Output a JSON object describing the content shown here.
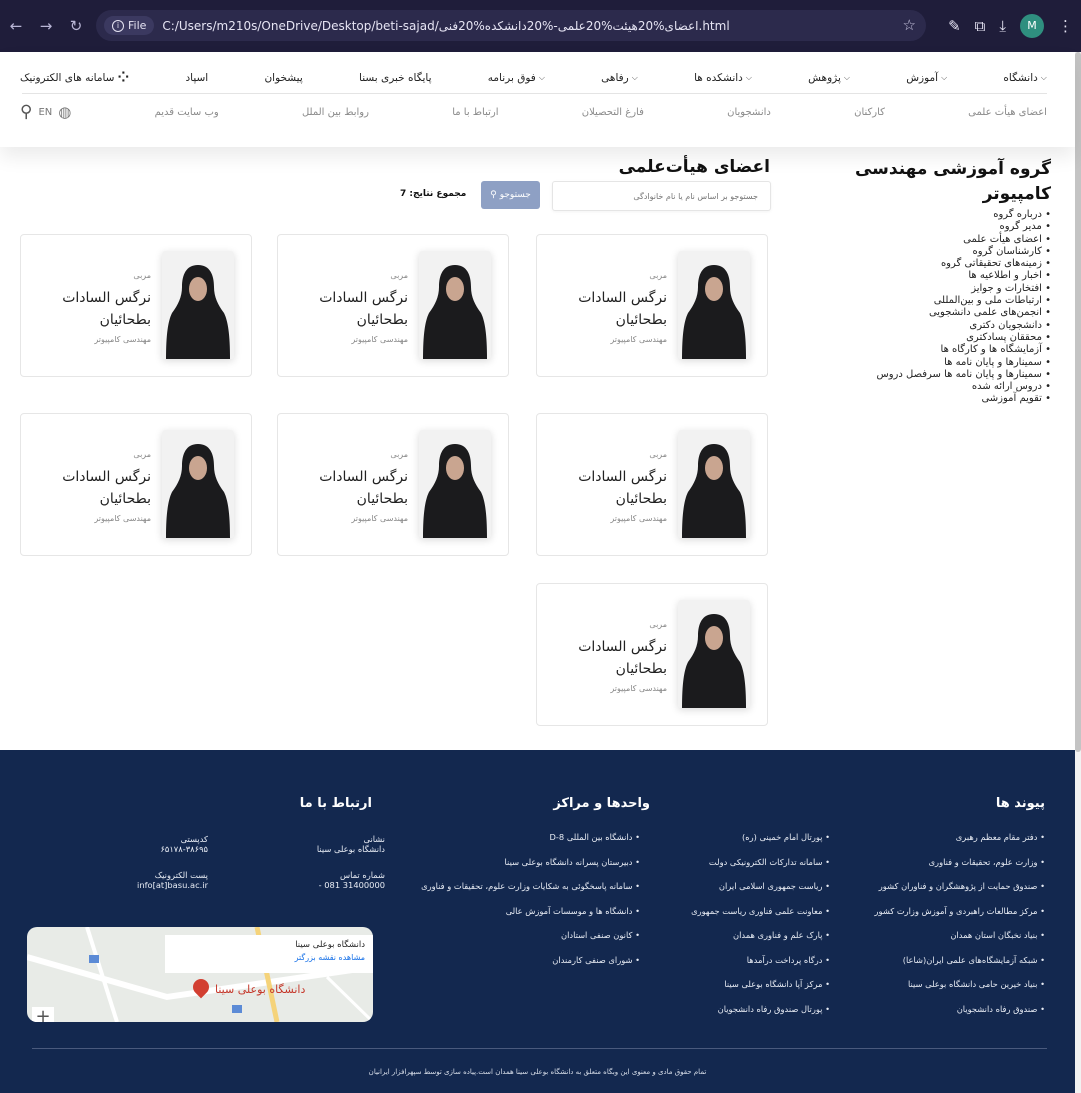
{
  "browser": {
    "file_label": "File",
    "url": "C:/Users/m210s/OneDrive/Desktop/beti-sajad/اعضای%20هیئت%20علمی-%20دانشکده%20فنی.html",
    "profile_initial": "M"
  },
  "menu": {
    "items": [
      "دانشگاه",
      "آموزش",
      "پژوهش",
      "دانشکده ها",
      "رفاهی",
      "فوق برنامه",
      "پایگاه خبری بسنا",
      "پیشخوان",
      "اسپاد",
      "سامانه های الکترونیک"
    ]
  },
  "submenu": {
    "items": [
      "اعضای هیأت علمی",
      "کارکنان",
      "دانشجویان",
      "فارغ التحصیلان",
      "ارتباط با ما",
      "روابط بین الملل",
      "وب سایت قدیم"
    ],
    "lang": "EN"
  },
  "sidebar": {
    "title": "گروه آموزشی مهندسی کامپیوتر",
    "items": [
      "درباره گروه",
      "مدیر گروه",
      "اعضای هیأت علمی",
      "کارشناسان گروه",
      "زمینه‌های تحقیقاتی گروه",
      "اخبار و اطلاعیه ها",
      "افتخارات و جوایز",
      "ارتباطات ملی و بین‌المللی",
      "انجمن‌های علمی دانشجویی",
      "دانشجویان دکتری",
      "محققان پسادکتری",
      "آزمایشگاه ها و کارگاه ها",
      "سمینارها و پایان نامه ها",
      "سمینارها و پایان نامه ها سرفصل دروس",
      "دروس ارائه شده",
      "تقویم آموزشی"
    ]
  },
  "main": {
    "title": "اعضای هیأت‌علمی",
    "search_placeholder": "جستوجو بر اساس نام یا نام خانوادگی",
    "search_button": "جستوجو",
    "result_count": "مجموع نتایج: 7"
  },
  "cards": [
    {
      "rank": "مربی",
      "name": "نرگس السادات بطحائیان",
      "dept": "مهندسی کامپیوتر"
    },
    {
      "rank": "مربی",
      "name": "نرگس السادات بطحائیان",
      "dept": "مهندسی کامپیوتر"
    },
    {
      "rank": "مربی",
      "name": "نرگس السادات بطحائیان",
      "dept": "مهندسی کامپیوتر"
    },
    {
      "rank": "مربی",
      "name": "نرگس السادات بطحائیان",
      "dept": "مهندسی کامپیوتر"
    },
    {
      "rank": "مربی",
      "name": "نرگس السادات بطحائیان",
      "dept": "مهندسی کامپیوتر"
    },
    {
      "rank": "مربی",
      "name": "نرگس السادات بطحائیان",
      "dept": "مهندسی کامپیوتر"
    },
    {
      "rank": "مربی",
      "name": "نرگس السادات بطحائیان",
      "dept": "مهندسی کامپیوتر"
    }
  ],
  "footer": {
    "links_title": "پیوند ها",
    "links_col1": [
      "دفتر مقام معظم رهبری",
      "وزارت علوم، تحقیقات و فناوری",
      "صندوق حمایت از پژوهشگران و فناوران کشور",
      "مرکز مطالعات راهبردی و آموزش وزارت کشور",
      "بنیاد نخبگان استان همدان",
      "شبکه آزمایشگاه‌های علمی ایران(شاعا)",
      "بنیاد خیرین حامی دانشگاه بوعلی سینا",
      "صندوق رفاه دانشجویان"
    ],
    "links_col2": [
      "پورتال امام خمینی (ره)",
      "سامانه تدارکات الکترونیکی دولت",
      "ریاست جمهوری اسلامی ایران",
      "معاونت علمی فناوری ریاست جمهوری",
      "پارک علم و فناوری همدان",
      "درگاه پرداخت درآمدها",
      "مرکز آپا دانشگاه بوعلی سینا",
      "پورتال صندوق رفاه دانشجویان"
    ],
    "units_title": "واحدها و مراکز",
    "units": [
      "دانشگاه بین المللی D-8",
      "دبیرستان پسرانه دانشگاه بوعلی سینا",
      "سامانه پاسخگوئی به شکایات وزارت علوم، تحقیقات و فناوری",
      "دانشگاه ها و موسسات آموزش عالی",
      "کانون صنفی استادان",
      "شورای صنفی کارمندان"
    ],
    "contact_title": "ارتباط با ما",
    "address_label": "نشانی",
    "address_value": "دانشگاه بوعلی سینا",
    "postal_label": "کدپستی",
    "postal_value": "۶۵۱۷۸-۳۸۶۹۵",
    "phone_label": "شماره تماس",
    "phone_value": "31400000 081 -",
    "email_label": "پست الکترونیک",
    "email_value": "info[at]basu.ac.ir",
    "map_title": "دانشگاه بوعلی سینا",
    "map_link": "مشاهده نقشه بزرگتر",
    "map_label": "دانشگاه بوعلی سینا",
    "copyright": "تمام حقوق مادی و معنوی این وبگاه متعلق به دانشگاه بوعلی سینا همدان است.پیاده سازی توسط سپهرافزار ایرانیان"
  }
}
